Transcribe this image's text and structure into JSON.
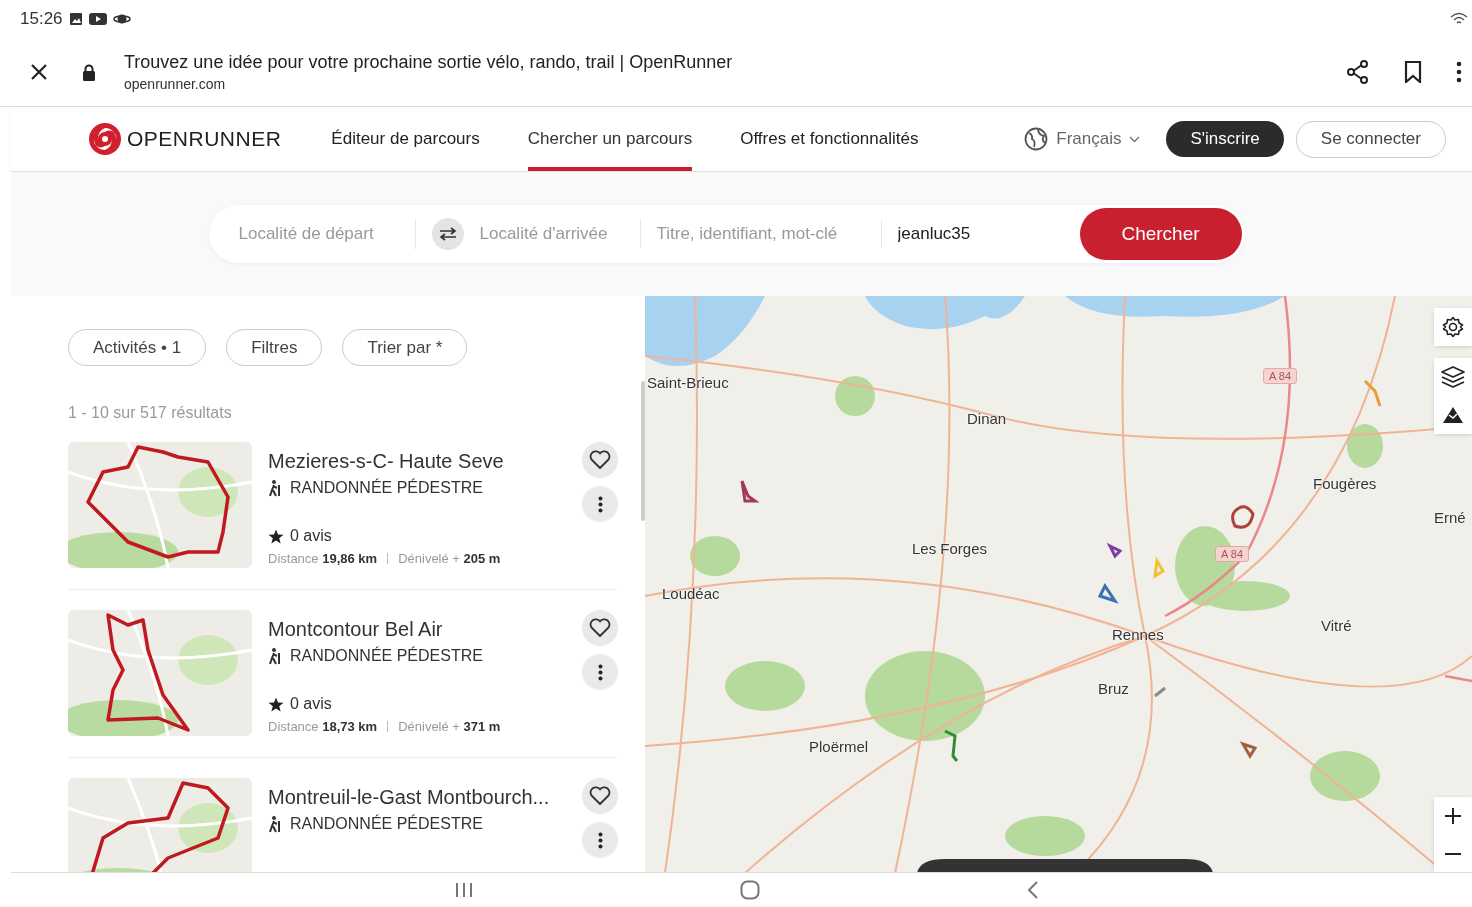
{
  "status_bar": {
    "time": "15:26"
  },
  "browser": {
    "title": "Trouvez une idée pour votre prochaine sortie vélo, rando, trail | OpenRunner",
    "url": "openrunner.com"
  },
  "site_nav": {
    "logo": "OPENRUNNER",
    "links": [
      {
        "label": "Éditeur de parcours",
        "selected": false
      },
      {
        "label": "Chercher un parcours",
        "selected": true
      },
      {
        "label": "Offres et fonctionnalités",
        "selected": false
      }
    ],
    "language": "Français",
    "signup": "S'inscrire",
    "login": "Se connecter"
  },
  "search": {
    "fields": [
      {
        "placeholder": "Localité de départ"
      },
      {
        "placeholder": "Localité d'arrivée"
      },
      {
        "placeholder": "Titre, identifiant, mot-clé"
      },
      {
        "value": "jeanluc35"
      }
    ],
    "button": "Chercher"
  },
  "filters": [
    "Activités • 1",
    "Filtres",
    "Trier par *"
  ],
  "results_count": "1 - 10 sur 517 résultats",
  "results": [
    {
      "title": "Mezieres-s-C- Haute Seve",
      "activity": "RANDONNÉE PÉDESTRE",
      "reviews": "0 avis",
      "distance_label": "Distance",
      "distance": "19,86 km",
      "elevation_label": "Dénivelé +",
      "elevation": "205 m"
    },
    {
      "title": "Montcontour Bel Air",
      "activity": "RANDONNÉE PÉDESTRE",
      "reviews": "0 avis",
      "distance_label": "Distance",
      "distance": "18,73 km",
      "elevation_label": "Dénivelé +",
      "elevation": "371 m"
    },
    {
      "title": "Montreuil-le-Gast Montbourch...",
      "activity": "RANDONNÉE PÉDESTRE"
    }
  ],
  "map": {
    "places": [
      "Saint-Brieuc",
      "Dinan",
      "Les Forges",
      "Loudéac",
      "Rennes",
      "Bruz",
      "Ploërmel",
      "Fougères",
      "Vitré",
      "Erné"
    ],
    "road_labels": [
      "A 84",
      "A 84"
    ]
  }
}
